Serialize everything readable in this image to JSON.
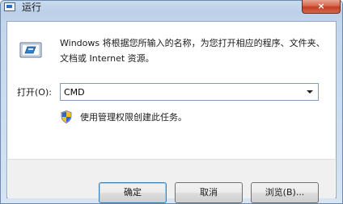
{
  "window": {
    "title": "运行",
    "close_label": "×"
  },
  "dialog": {
    "description": "Windows 将根据您所输入的名称，为您打开相应的程序、文件夹、文档或 Internet 资源。",
    "open_label": "打开(O):",
    "open_value": "CMD",
    "uac_text": "使用管理权限创建此任务。"
  },
  "buttons": {
    "ok": "确定",
    "cancel": "取消",
    "browse": "浏览(B)..."
  },
  "icons": {
    "title": "run-icon",
    "main": "run-program-icon",
    "uac": "uac-shield-icon",
    "dropdown": "chevron-down-icon"
  }
}
